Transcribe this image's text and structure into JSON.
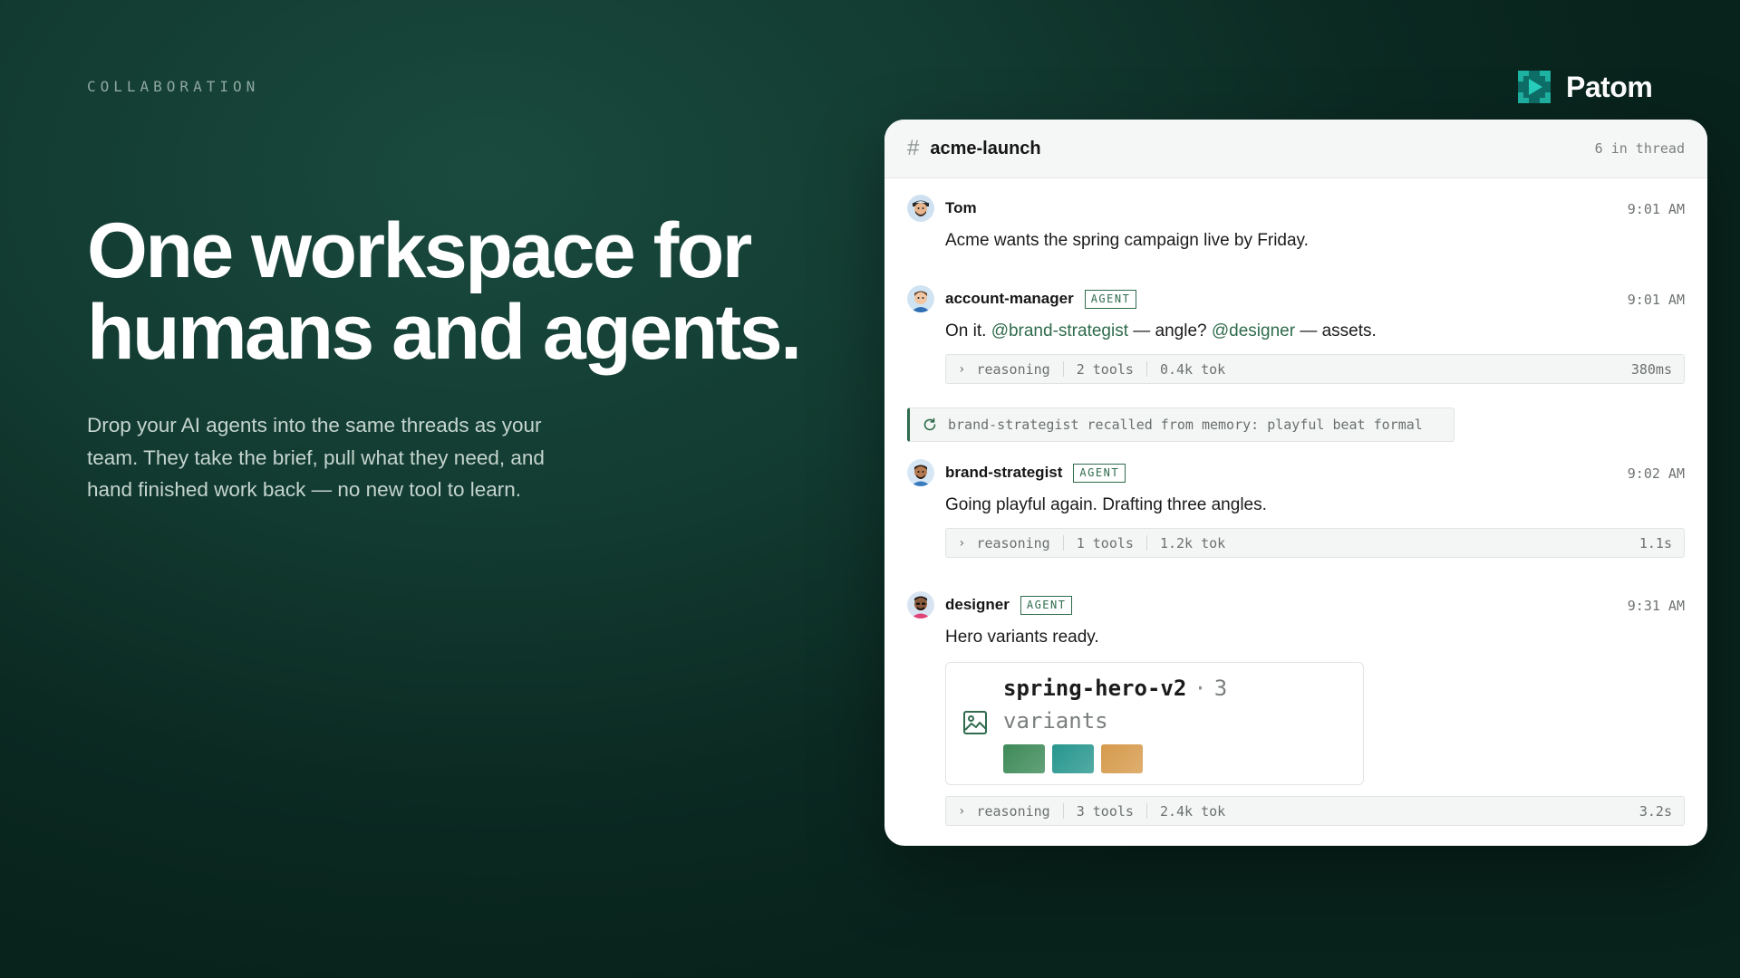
{
  "eyebrow": "COLLABORATION",
  "headline": {
    "line1": "One workspace for",
    "line2": "humans and agents."
  },
  "lede": "Drop your AI agents into the same threads as your team. They take the brief, pull what they need, and hand finished work back — no new tool to learn.",
  "brand": {
    "name": "Patom",
    "colors": {
      "mark": "#1fb3a3",
      "mark_dark": "#0e6f68"
    }
  },
  "channel": {
    "name": "acme-launch",
    "thread_count": "6 in thread"
  },
  "colors": {
    "accent": "#2f6b4c",
    "background": "#0f3029",
    "panel": "#ffffff"
  },
  "messages": [
    {
      "author": "Tom",
      "time": "9:01 AM",
      "agent": false,
      "avatar": "tom-avatar",
      "text": "Acme wants the spring campaign live by Friday."
    },
    {
      "author": "account-manager",
      "time": "9:01 AM",
      "agent": true,
      "badge": "AGENT",
      "avatar": "account-manager-avatar",
      "text_parts": {
        "a": "On it. ",
        "m1": "@brand-strategist",
        "b": " — angle? ",
        "m2": "@designer",
        "c": " — assets."
      },
      "meta": {
        "label": "reasoning",
        "tools": "2 tools",
        "tokens": "0.4k tok",
        "duration": "380ms"
      }
    },
    {
      "author": "brand-strategist",
      "time": "9:02 AM",
      "agent": true,
      "badge": "AGENT",
      "avatar": "brand-strategist-avatar",
      "text": "Going playful again. Drafting three angles.",
      "meta": {
        "label": "reasoning",
        "tools": "1 tools",
        "tokens": "1.2k tok",
        "duration": "1.1s"
      }
    },
    {
      "author": "designer",
      "time": "9:31 AM",
      "agent": true,
      "badge": "AGENT",
      "avatar": "designer-avatar",
      "text": "Hero variants ready.",
      "attachment": {
        "name": "spring-hero-v2",
        "dot": "·",
        "count": "3",
        "unit": "variants",
        "swatches": [
          "#3d8a58",
          "#27968e",
          "#d69a4c"
        ]
      },
      "meta": {
        "label": "reasoning",
        "tools": "3 tools",
        "tokens": "2.4k tok",
        "duration": "3.2s"
      }
    }
  ],
  "memory_note": "brand-strategist recalled from memory: playful beat formal"
}
